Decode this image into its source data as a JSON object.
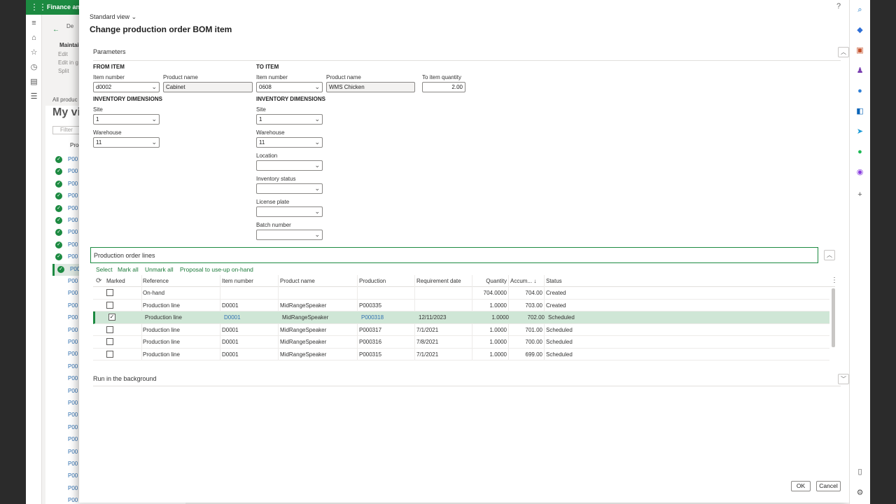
{
  "app": {
    "title": "Finance and"
  },
  "background": {
    "actions": [
      "De",
      "Maintain",
      "Edit",
      "Edit in g",
      "Split"
    ],
    "breadcrumb": "All produc",
    "view_title": "My vi",
    "filter_placeholder": "Filter",
    "column_header": "Prod",
    "row_code": "P00"
  },
  "dialog": {
    "view_selector": "Standard view",
    "title": "Change production order BOM item",
    "help": "?"
  },
  "parameters": {
    "section_title": "Parameters",
    "from_item": {
      "group_label": "FROM ITEM",
      "item_number_label": "Item number",
      "item_number": "d0002",
      "product_name_label": "Product name",
      "product_name": "Cabinet",
      "dims_label": "INVENTORY DIMENSIONS",
      "site_label": "Site",
      "site": "1",
      "warehouse_label": "Warehouse",
      "warehouse": "11"
    },
    "to_item": {
      "group_label": "TO ITEM",
      "item_number_label": "Item number",
      "item_number": "0608",
      "product_name_label": "Product name",
      "product_name": "WMS Chicken",
      "quantity_label": "To item quantity",
      "quantity": "2.00",
      "dims_label": "INVENTORY DIMENSIONS",
      "site_label": "Site",
      "site": "1",
      "warehouse_label": "Warehouse",
      "warehouse": "11",
      "location_label": "Location",
      "location": "",
      "inventory_status_label": "Inventory status",
      "inventory_status": "",
      "license_plate_label": "License plate",
      "license_plate": "",
      "batch_number_label": "Batch number",
      "batch_number": ""
    }
  },
  "lines": {
    "section_title": "Production order lines",
    "toolbar": [
      "Select",
      "Mark all",
      "Unmark all",
      "Proposal to use-up on-hand"
    ],
    "columns": [
      "Marked",
      "Reference",
      "Item number",
      "Product name",
      "Production",
      "Requirement date",
      "Quantity",
      "Accum...",
      "Status"
    ],
    "rows": [
      {
        "marked": false,
        "reference": "On-hand",
        "item": "",
        "product": "",
        "production": "",
        "date": "",
        "quantity": "704.0000",
        "accum": "704.00",
        "status": "Created"
      },
      {
        "marked": false,
        "reference": "Production line",
        "item": "D0001",
        "product": "MidRangeSpeaker",
        "production": "P000335",
        "date": "",
        "quantity": "1.0000",
        "accum": "703.00",
        "status": "Created"
      },
      {
        "marked": true,
        "reference": "Production line",
        "item": "D0001",
        "product": "MidRangeSpeaker",
        "production": "P000318",
        "date": "12/11/2023",
        "quantity": "1.0000",
        "accum": "702.00",
        "status": "Scheduled"
      },
      {
        "marked": false,
        "reference": "Production line",
        "item": "D0001",
        "product": "MidRangeSpeaker",
        "production": "P000317",
        "date": "7/1/2021",
        "quantity": "1.0000",
        "accum": "701.00",
        "status": "Scheduled"
      },
      {
        "marked": false,
        "reference": "Production line",
        "item": "D0001",
        "product": "MidRangeSpeaker",
        "production": "P000316",
        "date": "7/8/2021",
        "quantity": "1.0000",
        "accum": "700.00",
        "status": "Scheduled"
      },
      {
        "marked": false,
        "reference": "Production line",
        "item": "D0001",
        "product": "MidRangeSpeaker",
        "production": "P000315",
        "date": "7/1/2021",
        "quantity": "1.0000",
        "accum": "699.00",
        "status": "Scheduled"
      }
    ]
  },
  "run_in_background": {
    "section_title": "Run in the background"
  },
  "buttons": {
    "ok": "OK",
    "cancel": "Cancel"
  },
  "colors": {
    "accent": "#1c8a41",
    "link": "#2f6fb0",
    "selected_row": "#cfe6d6"
  }
}
